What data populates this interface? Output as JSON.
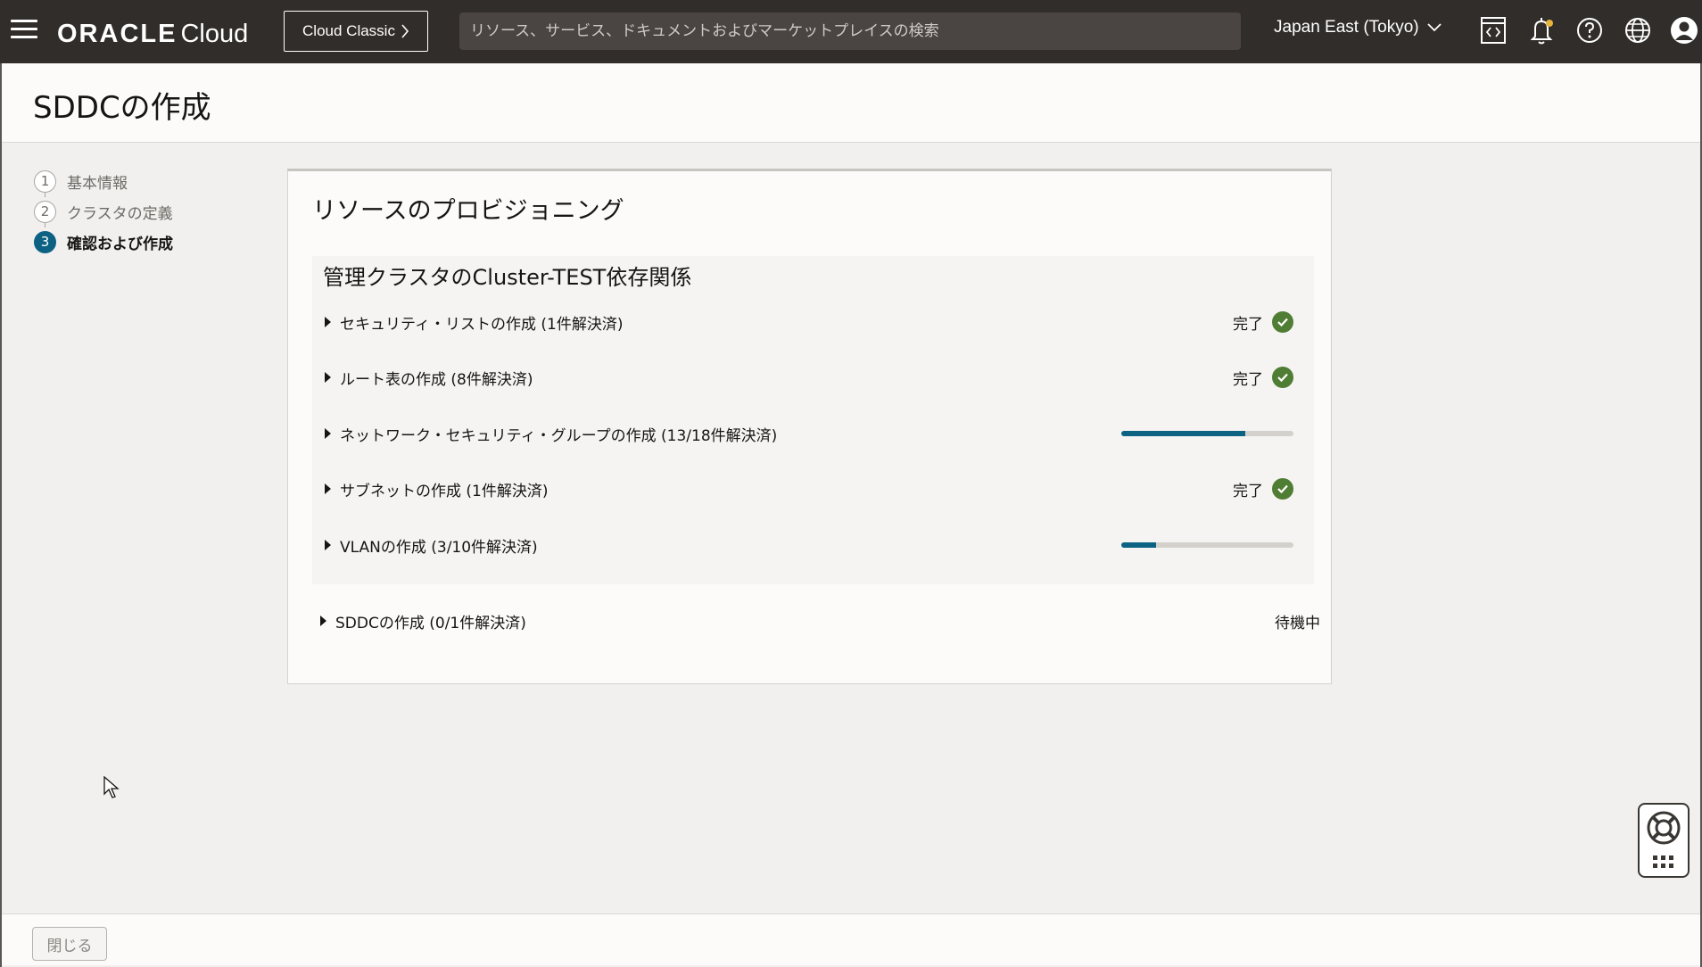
{
  "topbar": {
    "brand_oracle": "ORACLE",
    "brand_cloud": "Cloud",
    "classic_label": "Cloud Classic",
    "search_placeholder": "リソース、サービス、ドキュメントおよびマーケットプレイスの検索",
    "region": "Japan East (Tokyo)",
    "icons": [
      "menu-icon",
      "code-editor-icon",
      "bell-icon",
      "help-icon",
      "globe-icon",
      "profile-icon"
    ]
  },
  "page": {
    "title": "SDDCの作成"
  },
  "stepper": {
    "steps": [
      {
        "num": "1",
        "label": "基本情報"
      },
      {
        "num": "2",
        "label": "クラスタの定義"
      },
      {
        "num": "3",
        "label": "確認および作成"
      }
    ],
    "active_index": 2
  },
  "provisioning": {
    "title": "リソースのプロビジョニング",
    "group_title": "管理クラスタのCluster-TEST依存関係",
    "rows": [
      {
        "label": "セキュリティ・リストの作成 (1件解決済)",
        "status": "完了",
        "progress": null
      },
      {
        "label": "ルート表の作成 (8件解決済)",
        "status": "完了",
        "progress": null
      },
      {
        "label": "ネットワーク・セキュリティ・グループの作成 (13/18件解決済)",
        "status": null,
        "progress": 0.72
      },
      {
        "label": "サブネットの作成 (1件解決済)",
        "status": "完了",
        "progress": null
      },
      {
        "label": "VLANの作成 (3/10件解決済)",
        "status": null,
        "progress": 0.2
      }
    ],
    "sddc_row": {
      "label": "SDDCの作成 (0/1件解決済)",
      "status": "待機中"
    }
  },
  "footer": {
    "close_label": "閉じる"
  },
  "colors": {
    "topbar": "#312d2a",
    "accent": "#0d6283",
    "success": "#4f7d34"
  }
}
